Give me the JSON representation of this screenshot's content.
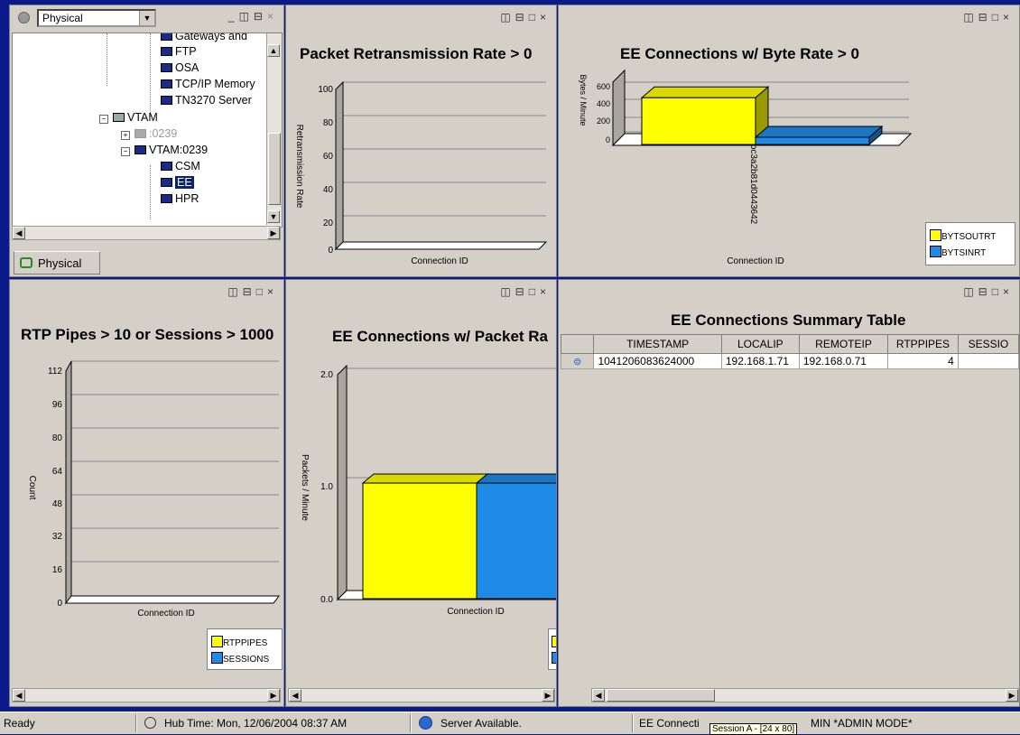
{
  "navigator": {
    "view_select": "Physical",
    "tree_items": [
      "Gateways and",
      "FTP",
      "OSA",
      "TCP/IP Memory",
      "TN3270 Server"
    ],
    "vtam_label": "VTAM",
    "vtam_node_dim": ":0239",
    "vtam_node": "VTAM:0239",
    "vtam_items": [
      "CSM",
      "EE",
      "HPR"
    ],
    "tab_label": "Physical"
  },
  "panel1": {
    "title": "Packet Retransmission Rate > 0",
    "chart_data": {
      "type": "bar",
      "title": "Packet Retransmission Rate > 0",
      "ylabel": "Retransmission Rate",
      "xlabel": "Connection ID",
      "yticks": [
        "100",
        "80",
        "60",
        "40",
        "20",
        "0"
      ],
      "ylim": [
        0,
        100
      ],
      "categories": [],
      "values": []
    }
  },
  "panel2": {
    "title": "EE Connections w/ Byte Rate > 0",
    "chart_data": {
      "type": "bar",
      "title": "EE Connections w/ Byte Rate > 0",
      "ylabel": "Bytes / Minute",
      "xlabel": "Connection ID",
      "yticks": [
        "600",
        "400",
        "200",
        "0"
      ],
      "ylim": [
        0,
        600
      ],
      "categories": [
        "bc3a2b81d0443642"
      ],
      "series": [
        {
          "name": "BYTSOUTRT",
          "values": [
            450
          ],
          "color": "#ffff00"
        },
        {
          "name": "BYTSINRT",
          "values": [
            70
          ],
          "color": "#1e8ce6"
        }
      ],
      "legend": "bottom-right"
    }
  },
  "panel3": {
    "title": "RTP Pipes > 10 or Sessions > 1000",
    "chart_data": {
      "type": "bar",
      "title": "RTP Pipes > 10 or Sessions > 1000",
      "ylabel": "Count",
      "xlabel": "Connection ID",
      "yticks": [
        "112",
        "96",
        "80",
        "64",
        "48",
        "32",
        "16",
        "0"
      ],
      "ylim": [
        0,
        112
      ],
      "categories": [],
      "series": [
        {
          "name": "RTPPIPES",
          "values": [],
          "color": "#ffff00"
        },
        {
          "name": "SESSIONS",
          "values": [],
          "color": "#1e8ce6"
        }
      ],
      "legend": "bottom-right"
    }
  },
  "panel4": {
    "title": "EE Connections w/ Packet Ra",
    "chart_data": {
      "type": "bar",
      "title": "EE Connections w/ Packet Ra",
      "ylabel": "Packets / Minute",
      "xlabel": "Connection ID",
      "yticks": [
        "2.0",
        "1.0",
        "0.0"
      ],
      "ylim": [
        0,
        2
      ],
      "categories": [
        ""
      ],
      "series": [
        {
          "values": [
            1.0
          ],
          "color": "#ffff00"
        },
        {
          "values": [
            1.0
          ],
          "color": "#1e8ce6"
        }
      ]
    }
  },
  "table_panel": {
    "title": "EE Connections Summary Table",
    "columns": [
      "TIMESTAMP",
      "LOCALIP",
      "REMOTEIP",
      "RTPPIPES",
      "SESSIO"
    ],
    "rows": [
      [
        "1041206083624000",
        "192.168.1.71",
        "192.168.0.71",
        "4",
        ""
      ]
    ]
  },
  "status": {
    "ready": "Ready",
    "hub_time": "Hub Time: Mon, 12/06/2004 08:37 AM",
    "server": "Server Available.",
    "workspace": "EE Connecti",
    "workspace_tail": "MIN   *ADMIN MODE*",
    "tooltip": "Session A - [24 x 80]"
  },
  "colors": {
    "yellow": "#ffff00",
    "blue": "#1e8ce6",
    "bg": "#d4d0c8",
    "desktop": "#0a1a8a"
  },
  "icons": [
    "split-vertical-icon",
    "split-horizontal-icon",
    "maximize-icon",
    "close-icon"
  ]
}
